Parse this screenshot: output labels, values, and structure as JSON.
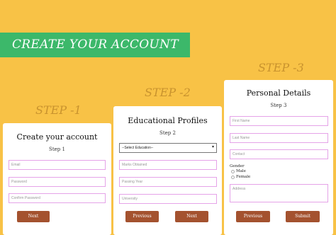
{
  "banner": {
    "title": "CREATE YOUR ACCOUNT"
  },
  "steps": [
    {
      "label": "STEP -1",
      "title": "Create your account",
      "subtitle": "Step 1",
      "fields": [
        "Email",
        "Password",
        "Confirm Password"
      ],
      "next": "Next"
    },
    {
      "label": "STEP -2",
      "title": "Educational Profiles",
      "subtitle": "Step 2",
      "select_value": "--Select Education--",
      "fields": [
        "Marks Obtained",
        "Passing Year",
        "University"
      ],
      "previous": "Previous",
      "next": "Next"
    },
    {
      "label": "STEP -3",
      "title": "Personal Details",
      "subtitle": "Step 3",
      "fields": [
        "First Name",
        "Last Name",
        "Contact"
      ],
      "gender_label": "Gender",
      "gender_options": [
        "Male",
        "Female"
      ],
      "address_placeholder": "Address",
      "previous": "Previous",
      "submit": "Submit"
    }
  ],
  "colors": {
    "background": "#f8c246",
    "banner": "#3cb86a",
    "step_label": "#c9932e",
    "button": "#a4522f",
    "field_border": "#e5a3e8"
  },
  "icons": {
    "select_arrow": "chevron-down-icon"
  }
}
